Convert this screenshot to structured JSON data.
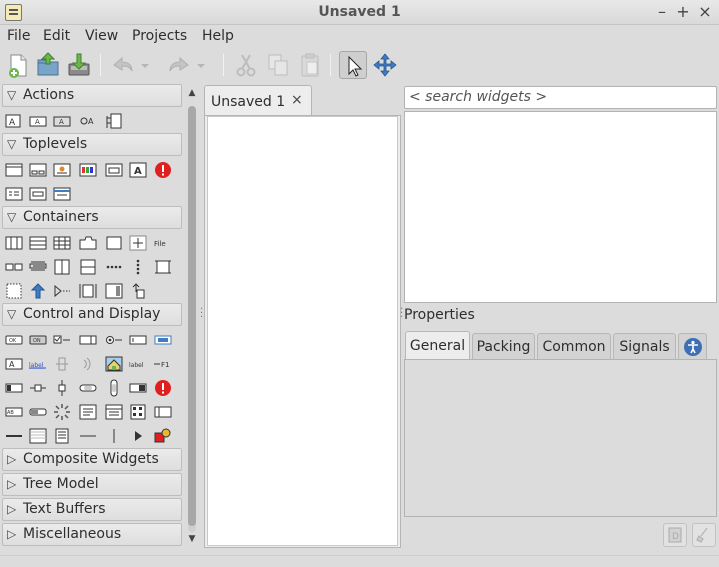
{
  "window": {
    "title": "Unsaved 1",
    "controls": [
      "–",
      "+",
      "×"
    ]
  },
  "menubar": {
    "items": [
      "File",
      "Edit",
      "View",
      "Projects",
      "Help"
    ]
  },
  "toolbar": {
    "buttons": [
      {
        "icon": "new-file-icon",
        "enabled": true
      },
      {
        "icon": "open-file-icon",
        "enabled": true
      },
      {
        "icon": "save-file-icon",
        "enabled": true
      },
      {
        "icon": "undo-icon",
        "enabled": false
      },
      {
        "icon": "undo-dropdown-icon",
        "enabled": false
      },
      {
        "icon": "redo-icon",
        "enabled": false
      },
      {
        "icon": "redo-dropdown-icon",
        "enabled": false
      },
      {
        "icon": "cut-icon",
        "enabled": false
      },
      {
        "icon": "copy-icon",
        "enabled": false
      },
      {
        "icon": "paste-icon",
        "enabled": false
      },
      {
        "icon": "selector-pointer-icon",
        "enabled": true,
        "active": true
      },
      {
        "icon": "drag-resize-icon",
        "enabled": true
      }
    ]
  },
  "palette": {
    "groups": [
      {
        "label": "Actions",
        "expanded": true,
        "icon_count": 5
      },
      {
        "label": "Toplevels",
        "expanded": true,
        "icon_count": 10
      },
      {
        "label": "Containers",
        "expanded": true,
        "icon_count": 21
      },
      {
        "label": "Control and Display",
        "expanded": true,
        "icon_count": 35
      },
      {
        "label": "Composite Widgets",
        "expanded": false
      },
      {
        "label": "Tree Model",
        "expanded": false
      },
      {
        "label": "Text Buffers",
        "expanded": false
      },
      {
        "label": "Miscellaneous",
        "expanded": false
      }
    ],
    "arrow_expanded": "▽",
    "arrow_collapsed": "▷",
    "scroll_up": "▲",
    "scroll_down": "▼"
  },
  "canvas": {
    "tab_label": "Unsaved 1",
    "close_glyph": "×"
  },
  "inspector": {
    "search_placeholder": "< search widgets >",
    "properties_label": "Properties",
    "tabs": [
      "General",
      "Packing",
      "Common",
      "Signals"
    ],
    "active_tab": "General"
  },
  "colors": {
    "window_bg": "#dcdcdc",
    "alert_red": "#e02020",
    "panel_white": "#ffffff"
  }
}
